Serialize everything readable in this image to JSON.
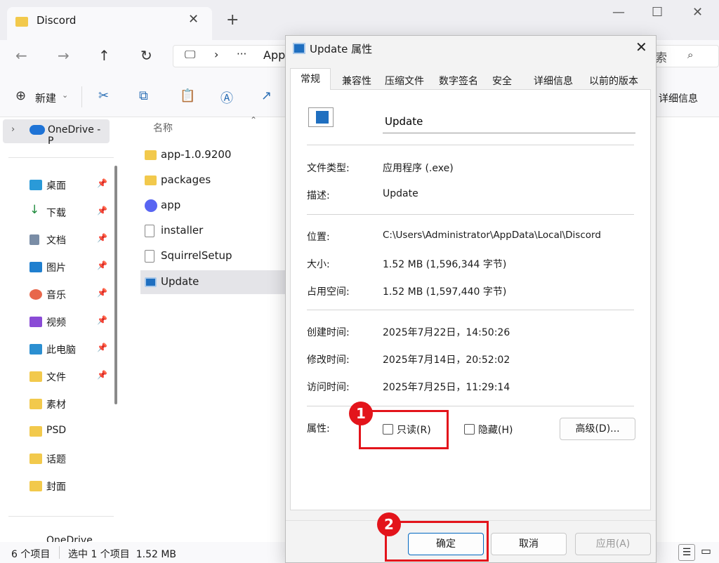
{
  "window": {
    "tab_title": "Discord",
    "new_tab": "+",
    "minimize": "—",
    "maximize": "☐",
    "close": "✕"
  },
  "address": {
    "path": "App",
    "more": "···",
    "chevron": "›",
    "search_text": "索"
  },
  "toolbar": {
    "new_label": "新建",
    "details_label": "详细信息"
  },
  "sidebar": {
    "onedrive_top": "OneDrive - P",
    "items": [
      {
        "label": "桌面",
        "icon": "desktop-icon",
        "pinned": true
      },
      {
        "label": "下载",
        "icon": "download-icon",
        "pinned": true
      },
      {
        "label": "文档",
        "icon": "document-icon",
        "pinned": true
      },
      {
        "label": "图片",
        "icon": "picture-icon",
        "pinned": true
      },
      {
        "label": "音乐",
        "icon": "music-icon",
        "pinned": true
      },
      {
        "label": "视频",
        "icon": "video-icon",
        "pinned": true
      },
      {
        "label": "此电脑",
        "icon": "computer-icon",
        "pinned": true
      },
      {
        "label": "文件",
        "icon": "folder-icon",
        "pinned": true
      },
      {
        "label": "素材",
        "icon": "folder-icon",
        "pinned": false
      },
      {
        "label": "PSD",
        "icon": "folder-icon",
        "pinned": false
      },
      {
        "label": "话题",
        "icon": "folder-icon",
        "pinned": false
      },
      {
        "label": "封面",
        "icon": "folder-icon",
        "pinned": false
      }
    ],
    "onedrive_bottom": "OneDrive"
  },
  "filelist": {
    "column_name": "名称",
    "files": [
      {
        "name": "app-1.0.9200",
        "icon": "folder-icon"
      },
      {
        "name": "packages",
        "icon": "folder-icon"
      },
      {
        "name": "app",
        "icon": "discord-icon"
      },
      {
        "name": "installer",
        "icon": "file-icon"
      },
      {
        "name": "SquirrelSetup",
        "icon": "file-icon"
      },
      {
        "name": "Update",
        "icon": "exe-icon"
      }
    ]
  },
  "status": {
    "count": "6 个项目",
    "selected": "选中 1 个项目  1.52 MB"
  },
  "dialog": {
    "title": "Update 属性",
    "tabs": [
      "常规",
      "兼容性",
      "压缩文件",
      "数字签名",
      "安全",
      "详细信息",
      "以前的版本"
    ],
    "filename": "Update",
    "rows": [
      {
        "label": "文件类型:",
        "value": "应用程序 (.exe)"
      },
      {
        "label": "描述:",
        "value": "Update"
      },
      {
        "label": "位置:",
        "value": "C:\\Users\\Administrator\\AppData\\Local\\Discord"
      },
      {
        "label": "大小:",
        "value": "1.52 MB (1,596,344 字节)"
      },
      {
        "label": "占用空间:",
        "value": "1.52 MB (1,597,440 字节)"
      },
      {
        "label": "创建时间:",
        "value": "2025年7月22日，14:50:26"
      },
      {
        "label": "修改时间:",
        "value": "2025年7月14日，20:52:02"
      },
      {
        "label": "访问时间:",
        "value": "2025年7月25日，11:29:14"
      }
    ],
    "attributes_label": "属性:",
    "readonly": "只读(R)",
    "hidden": "隐藏(H)",
    "advanced": "高级(D)...",
    "ok": "确定",
    "cancel": "取消",
    "apply": "应用(A)"
  },
  "annotations": {
    "step1": "1",
    "step2": "2",
    "color": "#e3141b"
  }
}
